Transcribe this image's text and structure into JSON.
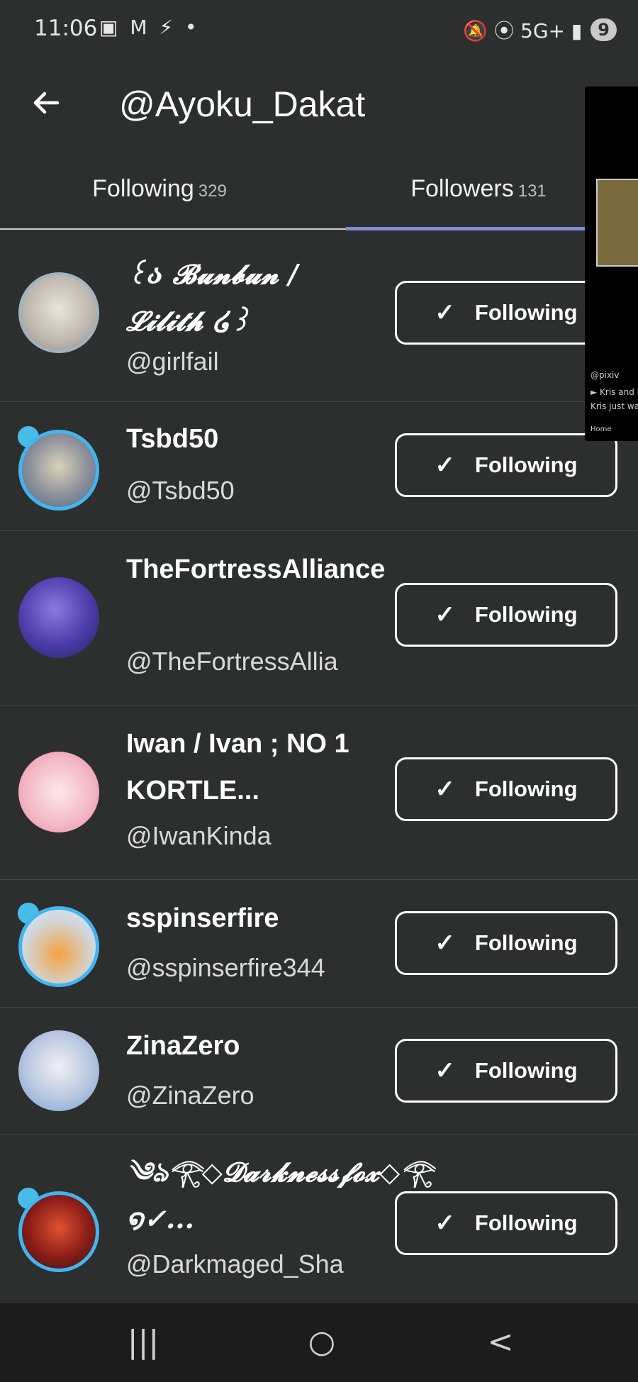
{
  "status_bar": {
    "time": "11:06",
    "left_icons": "▣ M ⚡ •",
    "right_icons": "🔕 ⦿ 5G+ ▮",
    "battery": "9"
  },
  "app_bar": {
    "title": "@Ayoku_Dakat"
  },
  "tabs": [
    {
      "label": "Following",
      "count": "329"
    },
    {
      "label": "Followers",
      "count": "131"
    }
  ],
  "users": [
    {
      "name": "꒰ა 𝓑𝓾𝓷𝓫𝓾𝓷 / 𝓛𝓲𝓵𝓲𝓽𝓱 ໒꒱",
      "handle": "@girlfail",
      "button": "Following"
    },
    {
      "name": "Tsbd50",
      "handle": "@Tsbd50",
      "button": "Following"
    },
    {
      "name": "TheFortressAlliance",
      "handle": "@TheFortressAllia",
      "button": "Following"
    },
    {
      "name": "Iwan / Ivan ; NO 1 KORTLE...",
      "handle": "@IwanKinda",
      "button": "Following"
    },
    {
      "name": "sspinserfire",
      "handle": "@sspinserfire344",
      "button": "Following"
    },
    {
      "name": "ZinaZero",
      "handle": "@ZinaZero",
      "button": "Following"
    },
    {
      "name": "༄ঌ𓂀◇𝓓𝓪𝓻𝓴𝓷𝓮𝓼𝓼𝓯𝓸𝔁◇𓂀 ໑✓...",
      "handle": "@Darkmaged_Sha",
      "button": "Following"
    }
  ],
  "pip": {
    "user": "@pixiv",
    "line1": "► Kris and I",
    "line2": "Kris just wan",
    "home": "Home"
  },
  "nav": {
    "recents": "|||",
    "home": "○",
    "back": "<"
  },
  "colors": {
    "background": "#2d2e2e",
    "tab_indicator": "#7b8fd6",
    "avatar_ring": "#42b5f0"
  }
}
